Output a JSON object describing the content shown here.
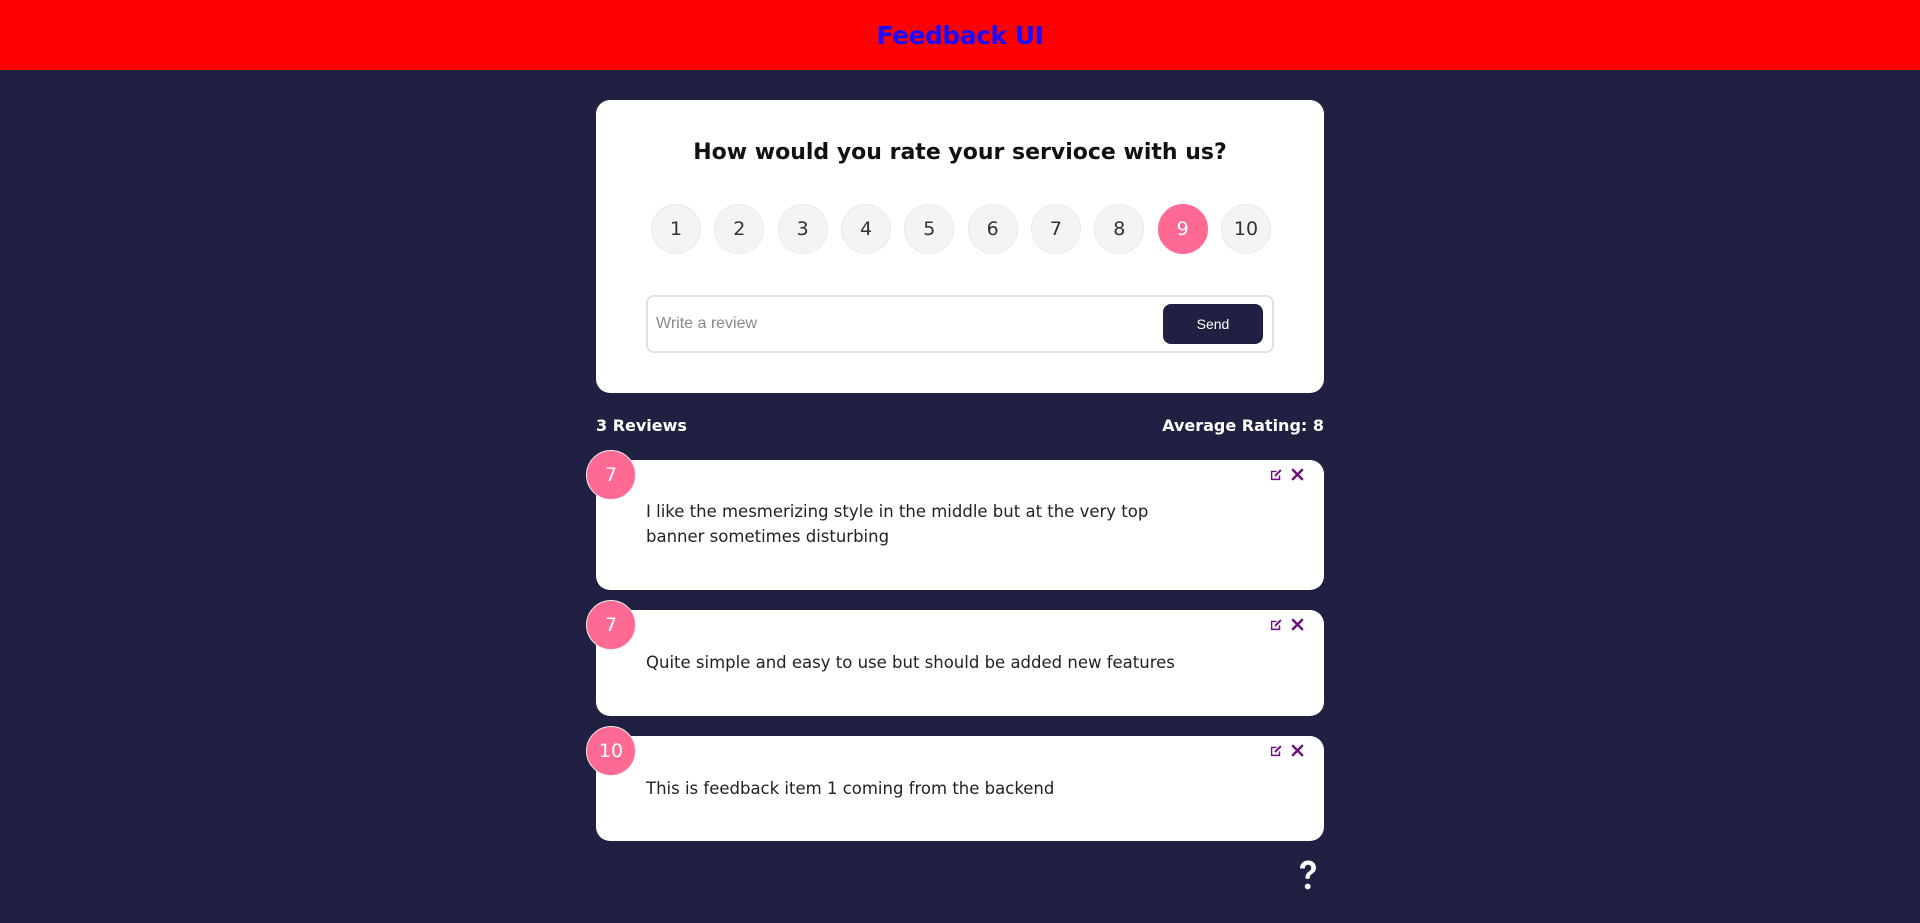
{
  "header": {
    "title": "Feedback UI"
  },
  "rating_card": {
    "question": "How would you rate your servioce with us?",
    "ratings": [
      "1",
      "2",
      "3",
      "4",
      "5",
      "6",
      "7",
      "8",
      "9",
      "10"
    ],
    "selected_rating": "9",
    "review_placeholder": "Write a review",
    "review_value": "",
    "send_label": "Send"
  },
  "stats": {
    "reviews_count": "3 Reviews",
    "average_rating": "Average Rating: 8"
  },
  "reviews": [
    {
      "rating": "7",
      "text": "I like the mesmerizing style in the middle but at the very top banner sometimes disturbing"
    },
    {
      "rating": "7",
      "text": "Quite simple and easy to use but should be added new features"
    },
    {
      "rating": "10",
      "text": "This is feedback item 1 coming from the backend"
    }
  ],
  "colors": {
    "header_bg": "#ff0000",
    "header_text": "#1a0dff",
    "page_bg": "#202142",
    "accent": "#ff6a95",
    "icon": "#6b0f7a"
  },
  "icons": {
    "edit": "edit-icon",
    "delete": "close-icon",
    "help": "question-mark-icon"
  }
}
